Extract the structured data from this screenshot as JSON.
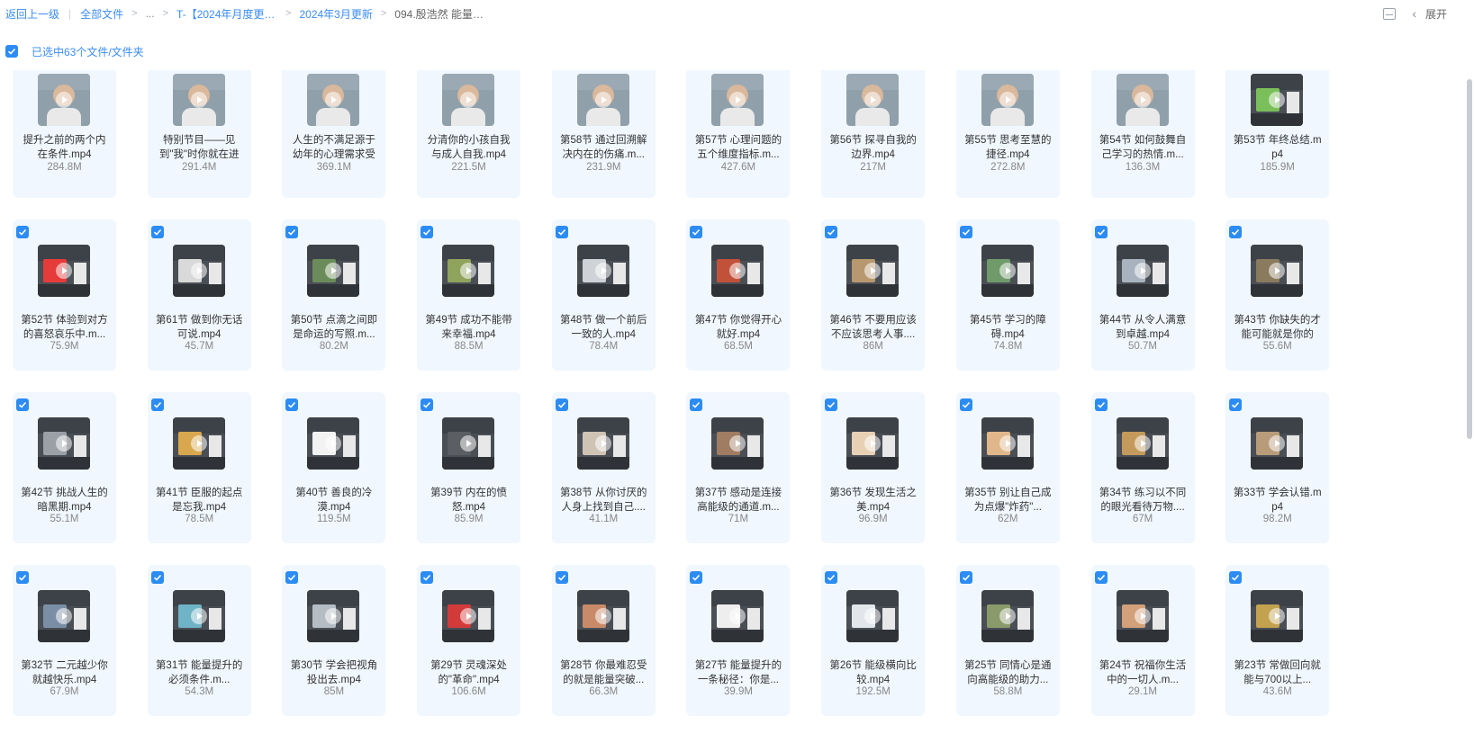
{
  "breadcrumb": {
    "back": "返回上一级",
    "all_files": "全部文件",
    "ellipsis": "...",
    "level1": "T-【2024年月度更新】",
    "level2": "2024年3月更新",
    "current": "094.殷浩然 能量课..."
  },
  "toolbar": {
    "expand_label": "展开"
  },
  "selection": {
    "label": "已选中63个文件/文件夹"
  },
  "rows": [
    {
      "first": true,
      "files": [
        {
          "name": "提升之前的两个内在条件.mp4",
          "size": "284.8M",
          "thumb": "person"
        },
        {
          "name": "特别节目——见到\"我\"时你就在进步",
          "size": "291.4M",
          "thumb": "person"
        },
        {
          "name": "人生的不满足源于幼年的心理需求受",
          "size": "369.1M",
          "thumb": "person"
        },
        {
          "name": "分清你的小孩自我与成人自我.mp4",
          "size": "221.5M",
          "thumb": "person"
        },
        {
          "name": "第58节 通过回溯解决内在的伤痛.m...",
          "size": "231.9M",
          "thumb": "person"
        },
        {
          "name": "第57节 心理问题的五个维度指标.m...",
          "size": "427.6M",
          "thumb": "person"
        },
        {
          "name": "第56节 探寻自我的边界.mp4",
          "size": "217M",
          "thumb": "person"
        },
        {
          "name": "第55节 思考至慧的捷径.mp4",
          "size": "272.8M",
          "thumb": "person"
        },
        {
          "name": "第54节 如何鼓舞自己学习的热情.m...",
          "size": "136.3M",
          "thumb": "person"
        },
        {
          "name": "第53节 年终总结.mp4",
          "size": "185.9M",
          "thumb": "slide",
          "color": "#7bbf5a"
        }
      ]
    },
    {
      "first": false,
      "files": [
        {
          "name": "第52节 体验到对方的喜怒哀乐中.m...",
          "size": "75.9M",
          "thumb": "slide",
          "color": "#e63b3b"
        },
        {
          "name": "第61节 做到你无话可说.mp4",
          "size": "45.7M",
          "thumb": "slide",
          "color": "#d9d9d9"
        },
        {
          "name": "第50节 点滴之间即是命运的写照.m...",
          "size": "80.2M",
          "thumb": "slide",
          "color": "#6b8c5a"
        },
        {
          "name": "第49节 成功不能带来幸福.mp4",
          "size": "88.5M",
          "thumb": "slide",
          "color": "#8fa35c"
        },
        {
          "name": "第48节 做一个前后一致的人.mp4",
          "size": "78.4M",
          "thumb": "slide",
          "color": "#cfd2d6"
        },
        {
          "name": "第47节 你觉得开心就好.mp4",
          "size": "68.5M",
          "thumb": "slide",
          "color": "#c2513a"
        },
        {
          "name": "第46节 不要用应该不应该思考人事....",
          "size": "86M",
          "thumb": "slide",
          "color": "#b7986f"
        },
        {
          "name": "第45节 学习的障碍.mp4",
          "size": "74.8M",
          "thumb": "slide",
          "color": "#6f9a6a"
        },
        {
          "name": "第44节 从令人满意到卓越.mp4",
          "size": "50.7M",
          "thumb": "slide",
          "color": "#a8b3bf"
        },
        {
          "name": "第43节 你缺失的才能可能就是你的",
          "size": "55.6M",
          "thumb": "slide",
          "color": "#8a7a5e"
        }
      ]
    },
    {
      "first": false,
      "files": [
        {
          "name": "第42节 挑战人生的暗黑期.mp4",
          "size": "55.1M",
          "thumb": "slide",
          "color": "#9aa0a6"
        },
        {
          "name": "第41节 臣服的起点是忘我.mp4",
          "size": "78.5M",
          "thumb": "slide",
          "color": "#d9a84e"
        },
        {
          "name": "第40节 善良的冷漠.mp4",
          "size": "119.5M",
          "thumb": "slide",
          "color": "#f2f2f2"
        },
        {
          "name": "第39节 内在的愤怒.mp4",
          "size": "85.9M",
          "thumb": "slide",
          "color": "#5b5e63"
        },
        {
          "name": "第38节 从你讨厌的人身上找到自己....",
          "size": "41.1M",
          "thumb": "slide",
          "color": "#cfc3b5"
        },
        {
          "name": "第37节 感动是连接高能级的通道.m...",
          "size": "71M",
          "thumb": "slide",
          "color": "#a07c62"
        },
        {
          "name": "第36节 发现生活之美.mp4",
          "size": "96.9M",
          "thumb": "slide",
          "color": "#e8d0b5"
        },
        {
          "name": "第35节 别让自己成为点爆\"炸药\"...",
          "size": "62M",
          "thumb": "slide",
          "color": "#e0b78a"
        },
        {
          "name": "第34节 练习以不同的眼光看待万物....",
          "size": "67M",
          "thumb": "slide",
          "color": "#c49a5c"
        },
        {
          "name": "第33节 学会认错.mp4",
          "size": "98.2M",
          "thumb": "slide",
          "color": "#b89c7a"
        }
      ]
    },
    {
      "first": false,
      "files": [
        {
          "name": "第32节 二元越少你就越快乐.mp4",
          "size": "67.9M",
          "thumb": "slide",
          "color": "#7a8fa6"
        },
        {
          "name": "第31节 能量提升的必须条件.m...",
          "size": "54.3M",
          "thumb": "slide",
          "color": "#6fb3c6"
        },
        {
          "name": "第30节 学会把视角投出去.mp4",
          "size": "85M",
          "thumb": "slide",
          "color": "#b5bcc4"
        },
        {
          "name": "第29节 灵魂深处的\"革命\".mp4",
          "size": "106.6M",
          "thumb": "slide",
          "color": "#d33b3b"
        },
        {
          "name": "第28节 你最难忍受的就是能量突破...",
          "size": "66.3M",
          "thumb": "slide",
          "color": "#c98a6a"
        },
        {
          "name": "第27节 能量提升的一条秘径：你是...",
          "size": "39.9M",
          "thumb": "slide",
          "color": "#eeeeee"
        },
        {
          "name": "第26节 能级横向比较.mp4",
          "size": "192.5M",
          "thumb": "slide",
          "color": "#e2e6ea"
        },
        {
          "name": "第25节 同情心是通向高能级的助力...",
          "size": "58.8M",
          "thumb": "slide",
          "color": "#8a9a6a"
        },
        {
          "name": "第24节 祝福你生活中的一切人.m...",
          "size": "29.1M",
          "thumb": "slide",
          "color": "#d2a07a"
        },
        {
          "name": "第23节 常做回向就能与700以上...",
          "size": "43.6M",
          "thumb": "slide",
          "color": "#c2a24e"
        }
      ]
    }
  ]
}
